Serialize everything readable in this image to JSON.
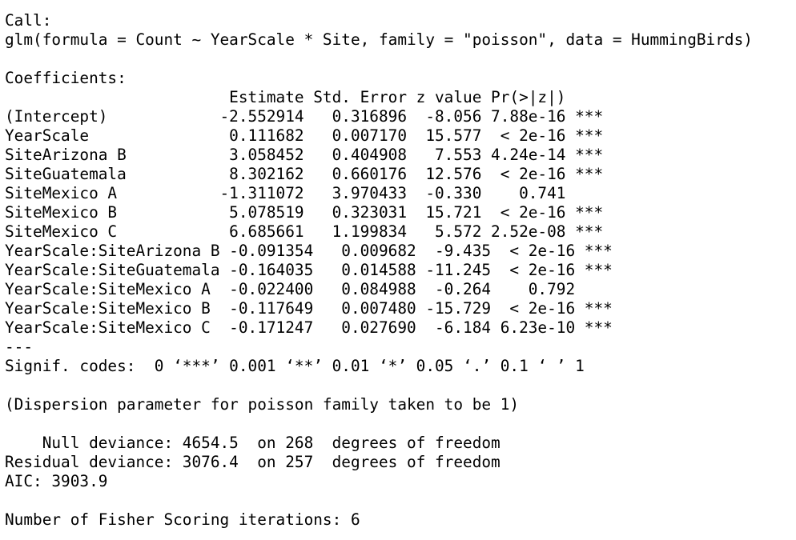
{
  "lines": [
    "Call:",
    "glm(formula = Count ~ YearScale * Site, family = \"poisson\", data = HummingBirds)",
    "",
    "Coefficients:",
    "                        Estimate Std. Error z value Pr(>|z|)    ",
    "(Intercept)            -2.552914   0.316896  -8.056 7.88e-16 ***",
    "YearScale               0.111682   0.007170  15.577  < 2e-16 ***",
    "SiteArizona B           3.058452   0.404908   7.553 4.24e-14 ***",
    "SiteGuatemala           8.302162   0.660176  12.576  < 2e-16 ***",
    "SiteMexico A           -1.311072   3.970433  -0.330    0.741    ",
    "SiteMexico B            5.078519   0.323031  15.721  < 2e-16 ***",
    "SiteMexico C            6.685661   1.199834   5.572 2.52e-08 ***",
    "YearScale:SiteArizona B -0.091354   0.009682  -9.435  < 2e-16 ***",
    "YearScale:SiteGuatemala -0.164035   0.014588 -11.245  < 2e-16 ***",
    "YearScale:SiteMexico A  -0.022400   0.084988  -0.264    0.792    ",
    "YearScale:SiteMexico B  -0.117649   0.007480 -15.729  < 2e-16 ***",
    "YearScale:SiteMexico C  -0.171247   0.027690  -6.184 6.23e-10 ***",
    "---",
    "Signif. codes:  0 ‘***’ 0.001 ‘**’ 0.01 ‘*’ 0.05 ‘.’ 0.1 ‘ ’ 1",
    "",
    "(Dispersion parameter for poisson family taken to be 1)",
    "",
    "    Null deviance: 4654.5  on 268  degrees of freedom",
    "Residual deviance: 3076.4  on 257  degrees of freedom",
    "AIC: 3903.9",
    "",
    "Number of Fisher Scoring iterations: 6"
  ]
}
